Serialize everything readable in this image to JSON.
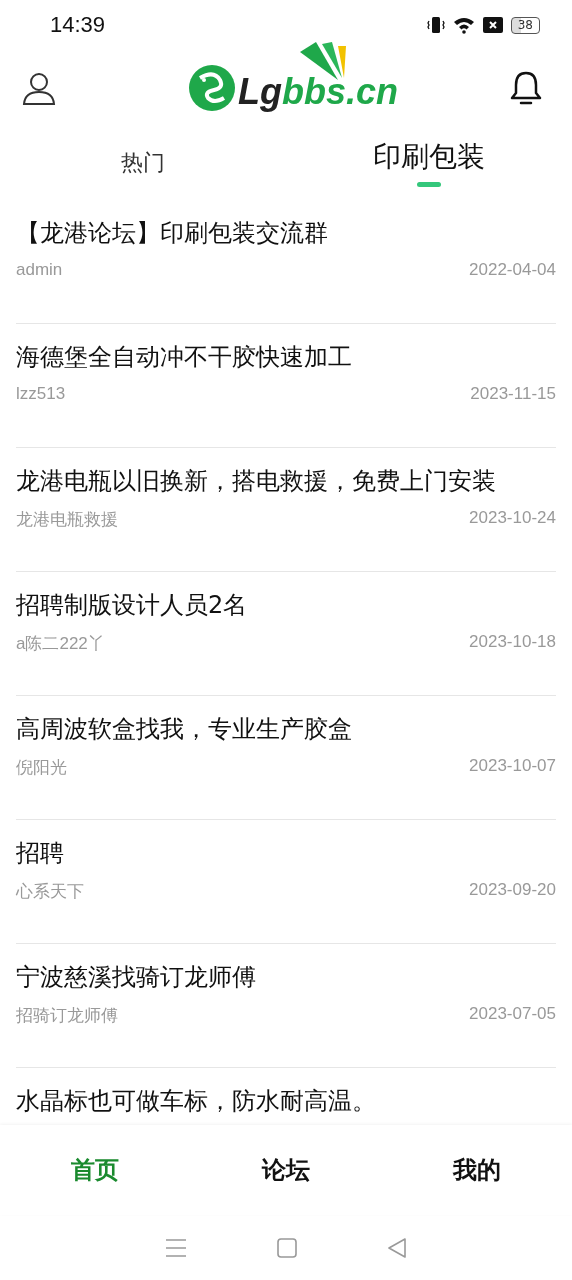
{
  "status_bar": {
    "time": "14:39",
    "battery": "38"
  },
  "header": {
    "logo": {
      "dark_part": "Lg",
      "green_part": "bbs.cn"
    }
  },
  "tabs": [
    {
      "label": "热门",
      "selected": false
    },
    {
      "label": "印刷包装",
      "selected": true
    }
  ],
  "posts": [
    {
      "title": "【龙港论坛】印刷包装交流群",
      "author": "admin",
      "date": "2022-04-04"
    },
    {
      "title": "海德堡全自动冲不干胶快速加工",
      "author": "lzz513",
      "date": "2023-11-15"
    },
    {
      "title": "龙港电瓶以旧换新，搭电救援，免费上门安装",
      "author": "龙港电瓶救援",
      "date": "2023-10-24"
    },
    {
      "title": "招聘制版设计人员2名",
      "author": "a陈二222丫",
      "date": "2023-10-18"
    },
    {
      "title": "高周波软盒找我，专业生产胶盒",
      "author": "倪阳光",
      "date": "2023-10-07"
    },
    {
      "title": "招聘",
      "author": "心系天下",
      "date": "2023-09-20"
    },
    {
      "title": "宁波慈溪找骑订龙师傅",
      "author": "招骑订龙师傅",
      "date": "2023-07-05"
    },
    {
      "title": "水晶标也可做车标，防水耐高温。"
    }
  ],
  "bottom_nav": [
    {
      "label": "首页",
      "selected": true
    },
    {
      "label": "论坛",
      "selected": false
    },
    {
      "label": "我的",
      "selected": false
    }
  ]
}
